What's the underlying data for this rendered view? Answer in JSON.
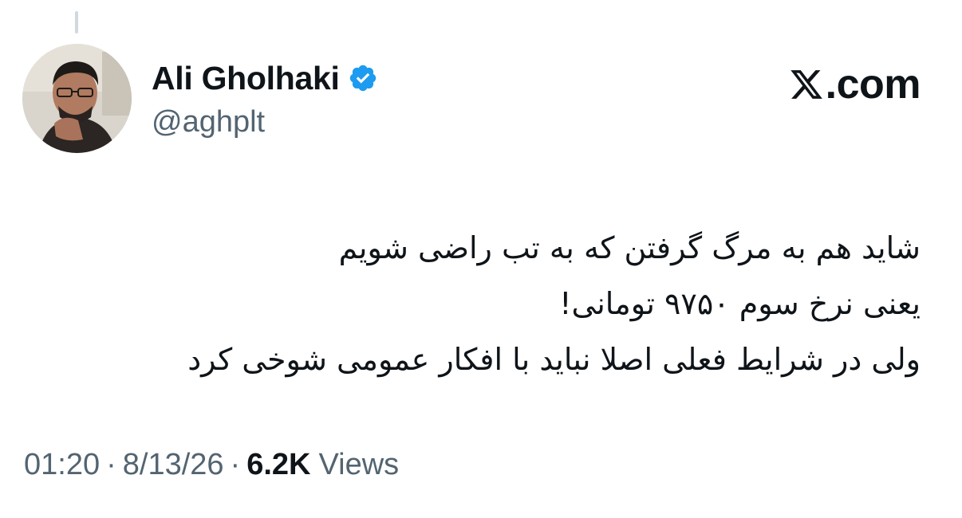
{
  "author": {
    "name": "Ali Gholhaki",
    "handle": "@aghplt",
    "verified_icon": "verified-badge-icon",
    "avatar_icon": "profile-photo"
  },
  "brand": {
    "text": ".com",
    "icon": "x-logo-icon"
  },
  "tweet": {
    "lines": [
      "شاید هم به مرگ گرفتن که به تب راضی شویم",
      "یعنی نرخ سوم ۹۷۵۰ تومانی!",
      "ولی در شرایط فعلی اصلا نباید با افکار عمومی شوخی کرد"
    ]
  },
  "meta": {
    "time": "01:20",
    "date": "8/13/26",
    "separator": "·",
    "views_count": "6.2K",
    "views_label": "Views"
  },
  "colors": {
    "text": "#0f1419",
    "secondary": "#536471",
    "verified": "#1d9bf0",
    "background": "#ffffff"
  }
}
